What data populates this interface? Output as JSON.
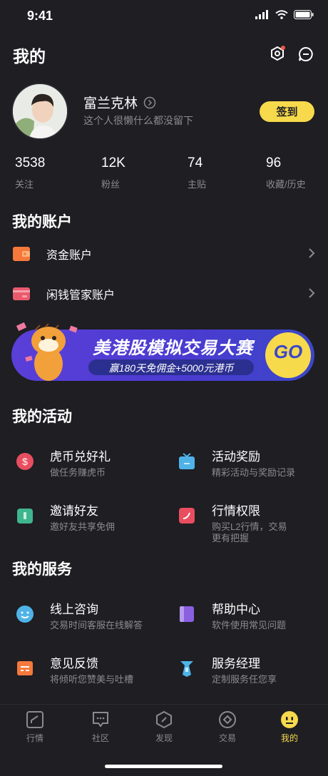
{
  "status": {
    "time": "9:41"
  },
  "header": {
    "title": "我的"
  },
  "profile": {
    "name": "富兰克林",
    "bio": "这个人很懒什么都没留下",
    "checkin_label": "签到"
  },
  "stats": [
    {
      "value": "3538",
      "label": "关注"
    },
    {
      "value": "12K",
      "label": "粉丝"
    },
    {
      "value": "74",
      "label": "主贴"
    },
    {
      "value": "96",
      "label": "收藏/历史"
    }
  ],
  "accounts": {
    "title": "我的账户",
    "items": [
      {
        "label": "资金账户",
        "icon": "wallet-icon",
        "color": "#f5793b"
      },
      {
        "label": "闲钱管家账户",
        "icon": "card-icon",
        "color": "#ea5a6d"
      }
    ]
  },
  "banner": {
    "title": "美港股模拟交易大赛",
    "subtitle": "赢180天免佣金+5000元港币",
    "go": "GO"
  },
  "activities": {
    "title": "我的活动",
    "items": [
      {
        "title": "虎币兑好礼",
        "desc": "做任务赚虎币",
        "icon": "coin-icon",
        "color": "#e84e5f"
      },
      {
        "title": "活动奖励",
        "desc": "精彩活动与奖励记录",
        "icon": "gift-icon",
        "color": "#4fb3e8"
      },
      {
        "title": "邀请好友",
        "desc": "邀好友共享免佣",
        "icon": "invite-icon",
        "color": "#3fb58f"
      },
      {
        "title": "行情权限",
        "desc": "购买L2行情，交易更有把握",
        "icon": "quote-icon",
        "color": "#e84e5f"
      }
    ]
  },
  "services": {
    "title": "我的服务",
    "items": [
      {
        "title": "线上咨询",
        "desc": "交易时间客服在线解答",
        "icon": "smile-icon",
        "color": "#4fb3e8"
      },
      {
        "title": "帮助中心",
        "desc": "软件使用常见问题",
        "icon": "help-book-icon",
        "color": "#8a5fe0"
      },
      {
        "title": "意见反馈",
        "desc": "将倾听您赞美与吐槽",
        "icon": "feedback-icon",
        "color": "#f5793b"
      },
      {
        "title": "服务经理",
        "desc": "定制服务任您享",
        "icon": "manager-icon",
        "color": "#4fb3e8"
      }
    ]
  },
  "tabs": [
    {
      "label": "行情",
      "icon": "chart-icon"
    },
    {
      "label": "社区",
      "icon": "community-icon"
    },
    {
      "label": "发现",
      "icon": "discover-icon"
    },
    {
      "label": "交易",
      "icon": "trade-icon"
    },
    {
      "label": "我的",
      "icon": "me-icon",
      "active": true
    }
  ],
  "colors": {
    "accent": "#f7d94c",
    "background": "#1e1e23",
    "muted": "#8a8a90"
  }
}
